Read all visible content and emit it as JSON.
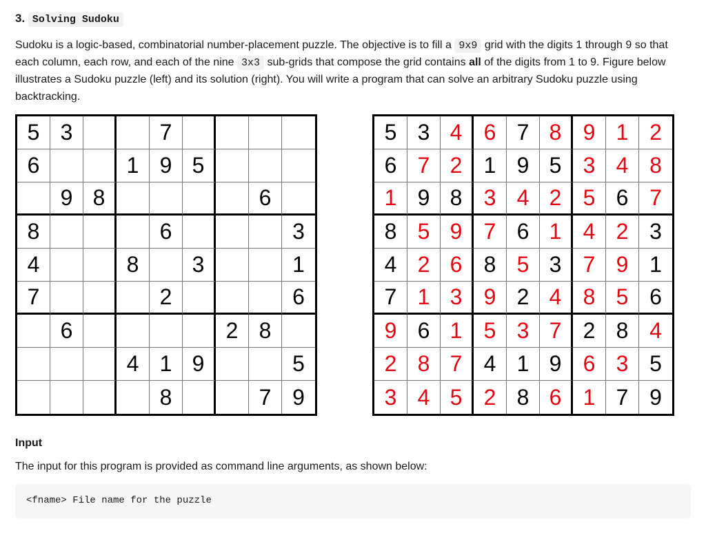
{
  "heading_prefix": "3. ",
  "heading_code": "Solving Sudoku",
  "para_parts": [
    "Sudoku is a logic-based, combinatorial number-placement puzzle. The objective is to fill a ",
    "9x9",
    " grid with the digits 1 through 9 so that each column, each row, and each of the nine ",
    "3x3",
    " sub-grids that compose the grid contains ",
    "all",
    " of the digits from 1 to 9. Figure below illustrates a Sudoku puzzle (left) and its solution (right). You will write a program that can solve an arbitrary Sudoku puzzle using backtracking."
  ],
  "sudoku_puzzle": [
    [
      5,
      3,
      0,
      0,
      7,
      0,
      0,
      0,
      0
    ],
    [
      6,
      0,
      0,
      1,
      9,
      5,
      0,
      0,
      0
    ],
    [
      0,
      9,
      8,
      0,
      0,
      0,
      0,
      6,
      0
    ],
    [
      8,
      0,
      0,
      0,
      6,
      0,
      0,
      0,
      3
    ],
    [
      4,
      0,
      0,
      8,
      0,
      3,
      0,
      0,
      1
    ],
    [
      7,
      0,
      0,
      0,
      2,
      0,
      0,
      0,
      6
    ],
    [
      0,
      6,
      0,
      0,
      0,
      0,
      2,
      8,
      0
    ],
    [
      0,
      0,
      0,
      4,
      1,
      9,
      0,
      0,
      5
    ],
    [
      0,
      0,
      0,
      0,
      8,
      0,
      0,
      7,
      9
    ]
  ],
  "sudoku_solution": [
    [
      5,
      3,
      4,
      6,
      7,
      8,
      9,
      1,
      2
    ],
    [
      6,
      7,
      2,
      1,
      9,
      5,
      3,
      4,
      8
    ],
    [
      1,
      9,
      8,
      3,
      4,
      2,
      5,
      6,
      7
    ],
    [
      8,
      5,
      9,
      7,
      6,
      1,
      4,
      2,
      3
    ],
    [
      4,
      2,
      6,
      8,
      5,
      3,
      7,
      9,
      1
    ],
    [
      7,
      1,
      3,
      9,
      2,
      4,
      8,
      5,
      6
    ],
    [
      9,
      6,
      1,
      5,
      3,
      7,
      2,
      8,
      4
    ],
    [
      2,
      8,
      7,
      4,
      1,
      9,
      6,
      3,
      5
    ],
    [
      3,
      4,
      5,
      2,
      8,
      6,
      1,
      7,
      9
    ]
  ],
  "input_heading": "Input",
  "input_text": "The input for this program is provided as command line arguments, as shown below:",
  "code_block": "<fname> File name for the puzzle"
}
